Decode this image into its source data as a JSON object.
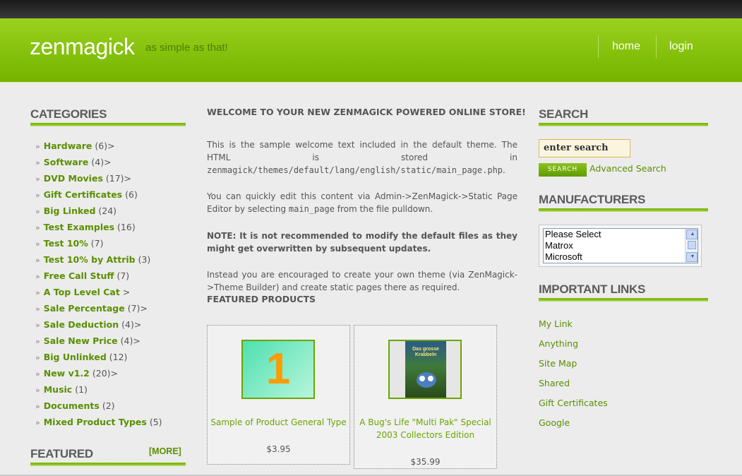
{
  "header": {
    "logo": "zenmagick",
    "tagline": "as simple as that!",
    "nav": [
      "home",
      "login"
    ]
  },
  "categories": {
    "title": "CATEGORIES",
    "items": [
      {
        "name": "Hardware",
        "count": "(6)>"
      },
      {
        "name": "Software",
        "count": "(4)>"
      },
      {
        "name": "DVD Movies",
        "count": "(17)>"
      },
      {
        "name": "Gift Certificates",
        "count": "(6)"
      },
      {
        "name": "Big Linked",
        "count": "(24)"
      },
      {
        "name": "Test Examples",
        "count": "(16)"
      },
      {
        "name": "Test 10%",
        "count": "(7)"
      },
      {
        "name": "Test 10% by Attrib",
        "count": "(3)"
      },
      {
        "name": "Free Call Stuff",
        "count": "(7)"
      },
      {
        "name": "A Top Level Cat",
        "count": ">"
      },
      {
        "name": "Sale Percentage",
        "count": "(7)>"
      },
      {
        "name": "Sale Deduction",
        "count": "(4)>"
      },
      {
        "name": "Sale New Price",
        "count": "(4)>"
      },
      {
        "name": "Big Unlinked",
        "count": "(12)"
      },
      {
        "name": "New v1.2",
        "count": "(20)>"
      },
      {
        "name": "Music",
        "count": "(1)"
      },
      {
        "name": "Documents",
        "count": "(2)"
      },
      {
        "name": "Mixed Product Types",
        "count": "(5)"
      }
    ]
  },
  "featured_box": {
    "title": "FEATURED",
    "more": "[MORE]"
  },
  "main": {
    "title": "WELCOME TO YOUR NEW ZENMAGICK POWERED ONLINE STORE!",
    "p1_text": "This is the sample welcome text included in the default theme. The HTML is stored in",
    "p1_path": "zenmagick/themes/default/lang/english/static/main_page.php",
    "p2_a": "You can quickly edit this content via Admin->ZenMagick->Static Page Editor by selecting",
    "p2_code": "main_page",
    "p2_b": "from the file pulldown.",
    "p3": "NOTE: It is not recommended to modify the default files as they might get overwritten by subsequent updates.",
    "p4": "Instead you are encouraged to create your own theme (via ZenMagick->Theme Builder) and create static pages there as required.",
    "featured_title": "FEATURED PRODUCTS",
    "products": [
      {
        "name": "Sample of Product General Type",
        "price": "$3.95",
        "image_text": "1"
      },
      {
        "name": "A Bug's Life \"Multi Pak\" Special 2003 Collectors Edition",
        "price": "$35.99",
        "image_text": "Das grosse Krabbeln"
      }
    ]
  },
  "search": {
    "title": "SEARCH",
    "input_value": "enter search",
    "button": "SEARCH",
    "advanced": "Advanced Search"
  },
  "manufacturers": {
    "title": "MANUFACTURERS",
    "options": [
      "Please Select",
      "Matrox",
      "Microsoft"
    ]
  },
  "links": {
    "title": "IMPORTANT LINKS",
    "items": [
      "My Link",
      "Anything",
      "Site Map",
      "Shared",
      "Gift Certificates",
      "Google"
    ]
  },
  "colors": {
    "brand_green": "#85c10c",
    "link_green": "#5a8f00"
  }
}
